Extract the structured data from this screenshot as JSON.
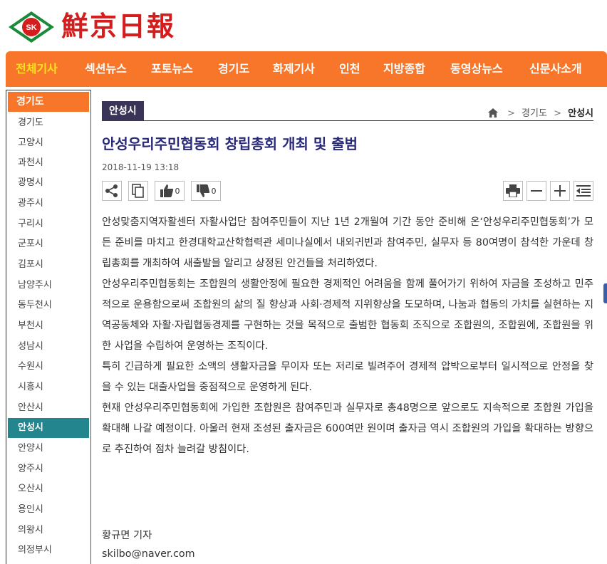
{
  "header": {
    "logo_emblem_text": "SK",
    "logo_title": "鮮京日報"
  },
  "nav": {
    "items": [
      "전체기사",
      "섹션뉴스",
      "포토뉴스",
      "경기도",
      "화제기사",
      "인천",
      "지방종합",
      "동영상뉴스",
      "신문사소개"
    ]
  },
  "sidebar": {
    "heading": "경기도",
    "items": [
      "경기도",
      "고양시",
      "과천시",
      "광명시",
      "광주시",
      "구리시",
      "군포시",
      "김포시",
      "남양주시",
      "동두천시",
      "부천시",
      "성남시",
      "수원시",
      "시흥시",
      "안산시",
      "안성시",
      "안양시",
      "양주시",
      "오산시",
      "용인시",
      "의왕시",
      "의정부시"
    ],
    "active_item": "안성시"
  },
  "breadcrumb": {
    "section_tag": "안성시",
    "path": [
      "경기도",
      "안성시"
    ],
    "separator": ">"
  },
  "article": {
    "title": "안성우리주민협동회 창립총회 개최 및 출범",
    "datetime": "2018-11-19 13:18",
    "likes": "0",
    "dislikes": "0",
    "paragraphs": [
      "안성맞춤지역자활센터 자활사업단 참여주민들이 지난 1년 2개월여 기간 동안 준비해 온‘안성우리주민협동회’가 모든 준비를 마치고 한경대학교산학협력관 세미나실에서 내외귀빈과 참여주민, 실무자 등 80여명이 참석한 가운데 창립총회를 개최하여 새출발을 알리고 상정된 안건들을 처리하였다.",
      "안성우리주민협동회는 조합원의 생활안정에 필요한 경제적인 어려움을 함께 풀어가기 위하여 자금을 조성하고 민주적으로 운용함으로써 조합원의 삶의 질 향상과 사회·경제적 지위향상을 도모하며, 나눔과 협동의 가치를 실현하는 지역공동체와 자활·자립협동경제를 구현하는 것을 목적으로 출범한 협동회 조직으로 조합원의, 조합원에, 조합원을 위한 사업을 수립하여 운영하는 조직이다.",
      "특히 긴급하게 필요한 소액의 생활자금을 무이자 또는 저리로 빌려주어 경제적 압박으로부터 일시적으로 안정을 찾을 수 있는 대출사업을 중점적으로 운영하게 된다.",
      "현재 안성우리주민협동회에 가입한 조합원은 참여주민과 실무자로 총48명으로 앞으로도 지속적으로 조합원 가입을 확대해 나갈 예정이다. 아울러 현재 조성된 출자금은 600여만 원이며 출자금 역시 조합원의 가입을 확대하는 방향으로 추진하여 점차 늘려갈 방침이다."
    ],
    "reporter": "황규면 기자",
    "email": "skilbo@naver.com"
  },
  "toolbar": {
    "icons": [
      "share-icon",
      "copy-icon",
      "thumbs-up-icon",
      "thumbs-down-icon",
      "print-icon",
      "font-decrease-icon",
      "font-increase-icon",
      "list-icon"
    ]
  },
  "colors": {
    "nav_bg": "#f7762a",
    "nav_active_text": "#ffe21f",
    "sidebar_active_bg": "#23868f",
    "section_tag_bg": "#3a3558",
    "title_color": "#2a2a7a",
    "logo_red": "#d41e1e",
    "logo_green": "#1a8a3a"
  }
}
